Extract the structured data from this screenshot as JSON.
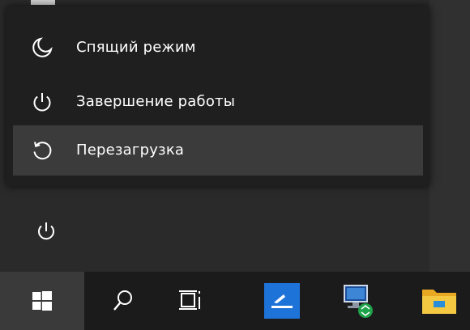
{
  "power_menu": {
    "items": [
      {
        "label": "Спящий режим",
        "icon": "sleep-moon-icon"
      },
      {
        "label": "Завершение работы",
        "icon": "power-icon"
      },
      {
        "label": "Перезагрузка",
        "icon": "restart-icon"
      }
    ]
  },
  "start_menu": {
    "power_button_icon": "power-icon"
  },
  "taskbar": {
    "icons": [
      "windows-start-icon",
      "search-icon",
      "task-view-icon",
      "blue-app-icon",
      "network-computer-icon",
      "file-explorer-folder-icon"
    ]
  },
  "colors": {
    "menu_background": "#1f1f1f",
    "menu_selected": "#3b3b3b",
    "taskbar": "#1b1b1b",
    "text": "#ffffff",
    "accent_blue": "#1e73d9",
    "folder_yellow": "#f2c12e"
  }
}
